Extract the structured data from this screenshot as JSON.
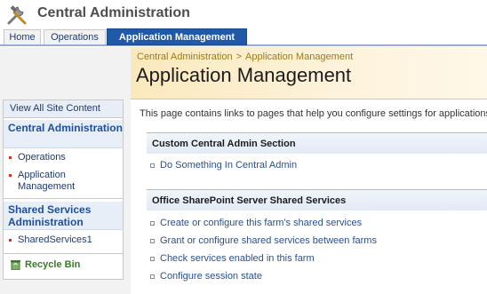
{
  "header": {
    "title": "Central Administration",
    "icon": "tools-icon"
  },
  "tabs": [
    {
      "label": "Home"
    },
    {
      "label": "Operations"
    },
    {
      "label": "Application Management",
      "active": true
    }
  ],
  "title_band": {
    "breadcrumb": [
      "Central Administration",
      "Application Management"
    ],
    "breadcrumb_separator": ">",
    "page_title": "Application Management"
  },
  "quick_launch": {
    "view_all": "View All Site Content",
    "groups": [
      {
        "heading": "Central Administration",
        "items": [
          "Operations",
          "Application Management"
        ]
      },
      {
        "heading": "Shared Services Administration",
        "items": [
          "SharedServices1"
        ]
      }
    ],
    "recycle_bin": "Recycle Bin"
  },
  "main": {
    "intro": "This page contains links to pages that help you configure settings for applications",
    "sections": [
      {
        "heading": "Custom Central Admin Section",
        "links": [
          "Do Something In Central Admin"
        ]
      },
      {
        "heading": "Office SharePoint Server Shared Services",
        "links": [
          "Create or configure this farm's shared services",
          "Grant or configure shared services between farms",
          "Check services enabled in this farm",
          "Configure session state"
        ]
      }
    ]
  },
  "colors": {
    "active_tab": "#2059a8",
    "title_band": "#fbe9bd",
    "link": "#2c4f8e",
    "bullet": "#c0392b",
    "recycle": "#3a7a2a"
  }
}
